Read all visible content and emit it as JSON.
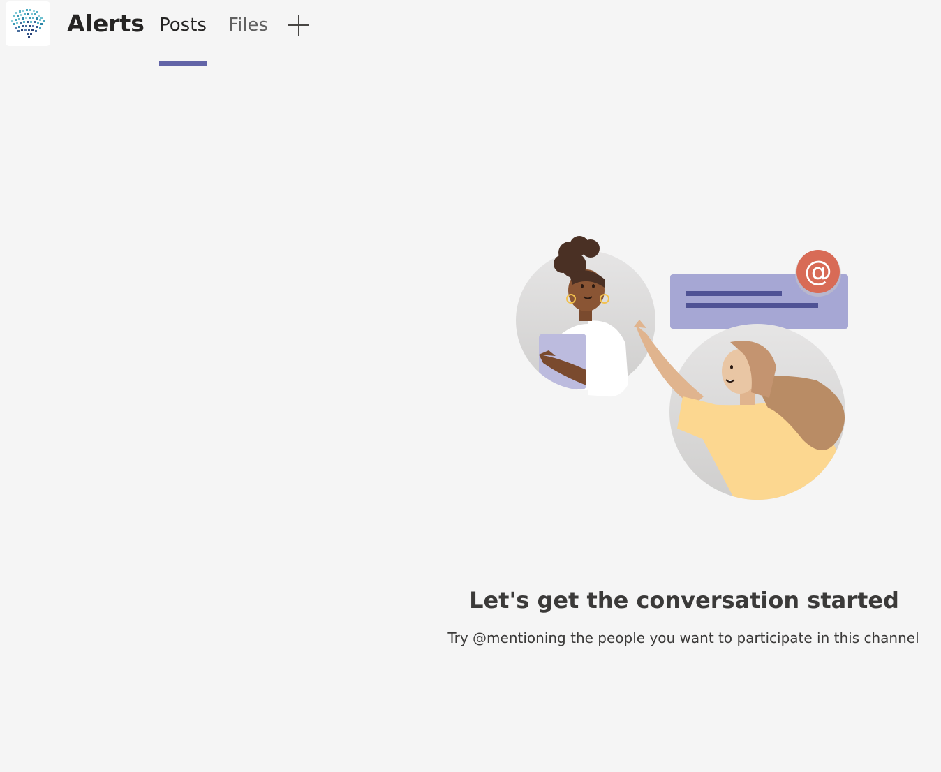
{
  "header": {
    "logo_icon": "team-brain-logo",
    "channel_name": "Alerts",
    "tabs": [
      {
        "label": "Posts",
        "active": true
      },
      {
        "label": "Files",
        "active": false
      }
    ],
    "add_tab_icon": "plus-icon"
  },
  "empty_state": {
    "illustration": "people-mention-illustration",
    "title": "Let's get the conversation started",
    "subtitle": "Try @mentioning the people you want to participate in this channel"
  },
  "colors": {
    "accent": "#6264a7",
    "background": "#f5f5f5",
    "mention_badge": "#d86b56",
    "bubble": "#a6a7d4"
  }
}
